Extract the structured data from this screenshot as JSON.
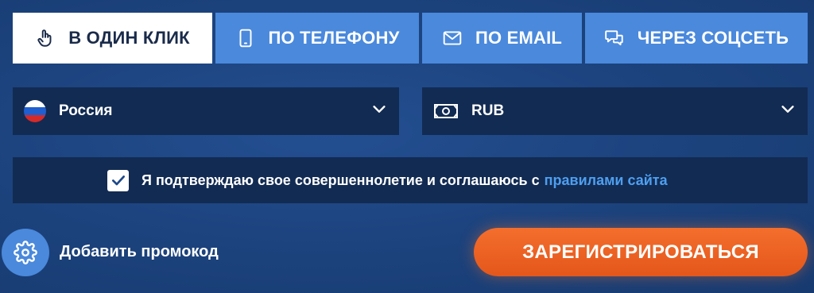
{
  "tabs": [
    {
      "label": "В ОДИН КЛИК",
      "icon": "pointer-hand-icon",
      "active": true
    },
    {
      "label": "ПО ТЕЛЕФОНУ",
      "icon": "phone-icon",
      "active": false
    },
    {
      "label": "ПО EMAIL",
      "icon": "envelope-icon",
      "active": false
    },
    {
      "label": "ЧЕРЕЗ СОЦСЕТЬ",
      "icon": "chat-bubbles-icon",
      "active": false
    }
  ],
  "country": {
    "value": "Россия",
    "icon": "russia-flag-icon"
  },
  "currency": {
    "value": "RUB",
    "icon": "banknote-icon"
  },
  "agreement": {
    "checked": true,
    "text": "Я подтверждаю свое совершеннолетие и соглашаюсь с",
    "link": "правилами сайта"
  },
  "promo": {
    "label": "Добавить промокод",
    "icon": "gear-icon"
  },
  "register": {
    "label": "ЗАРЕГИСТРИРОВАТЬСЯ"
  },
  "colors": {
    "tab": "#4a89dc",
    "tab_active": "#ffffff",
    "field": "#122b53",
    "link": "#4e9ff0",
    "cta": "#f06a28"
  }
}
